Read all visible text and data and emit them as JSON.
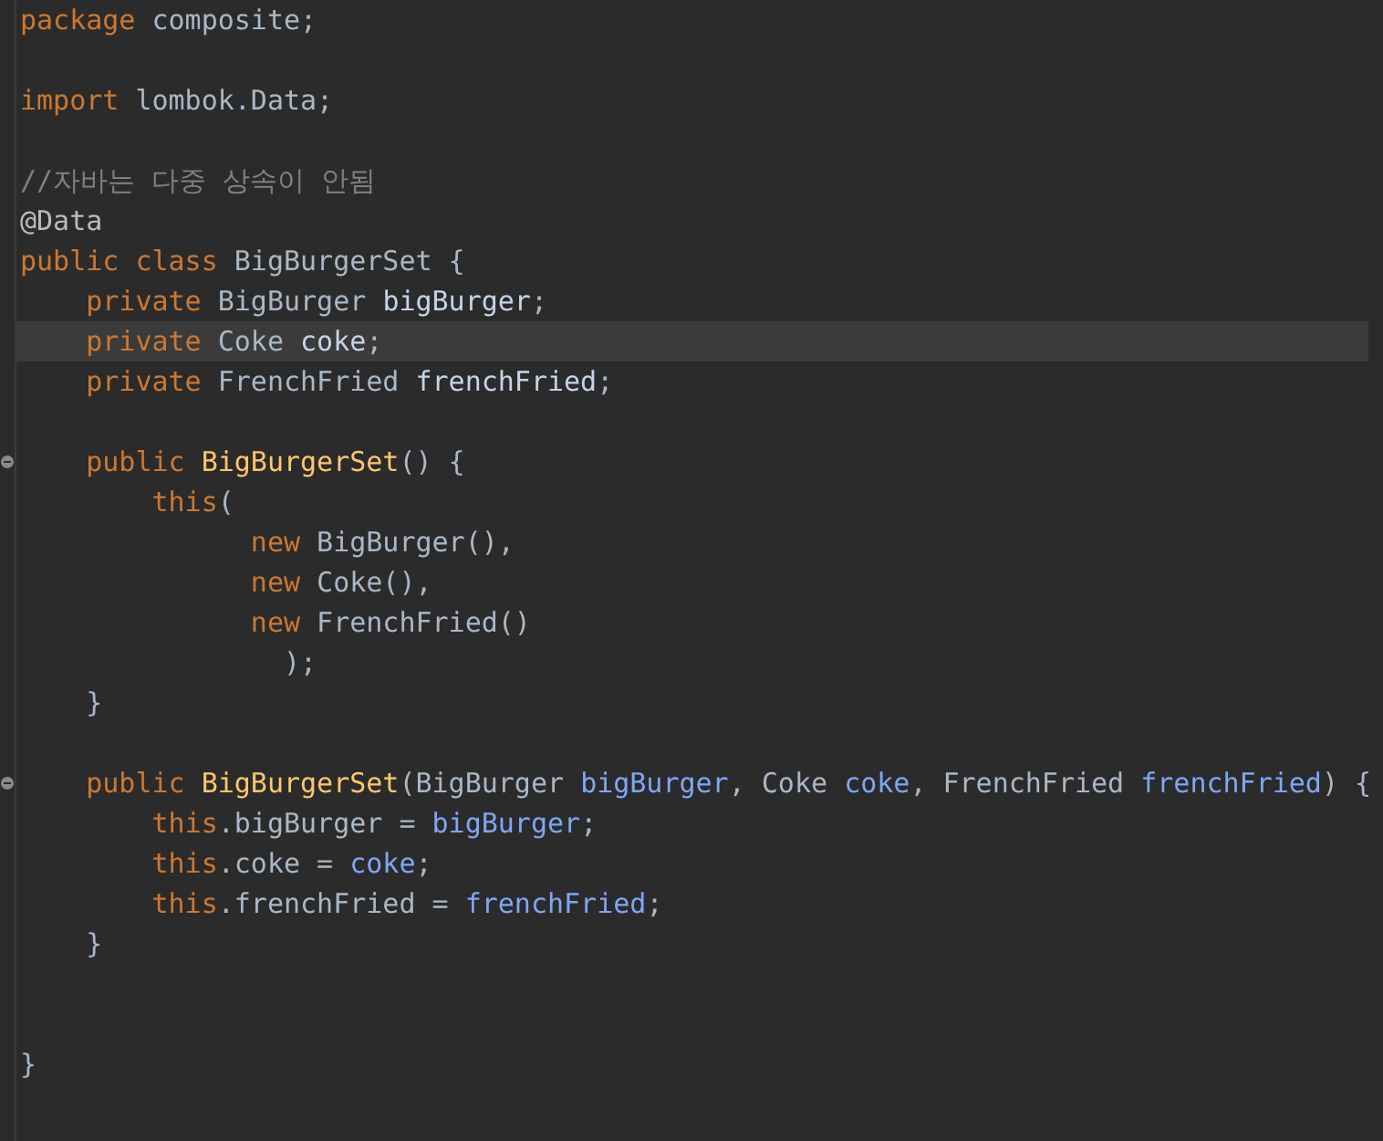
{
  "editor": {
    "lines": [
      {
        "current": false,
        "foldable": false,
        "tokens": [
          {
            "kind": "keyword",
            "text": "package"
          },
          {
            "kind": "plain",
            "text": " composite;"
          }
        ]
      },
      {
        "current": false,
        "foldable": false
      },
      {
        "current": false,
        "foldable": false,
        "tokens": [
          {
            "kind": "keyword",
            "text": "import"
          },
          {
            "kind": "plain",
            "text": " lombok.Data;"
          }
        ]
      },
      {
        "current": false,
        "foldable": false
      },
      {
        "current": false,
        "foldable": false,
        "tokens": [
          {
            "kind": "comment",
            "text": "//자바는 다중 상속이 안됨"
          }
        ]
      },
      {
        "current": false,
        "foldable": false,
        "tokens": [
          {
            "kind": "annotation",
            "text": "@Data"
          }
        ]
      },
      {
        "current": false,
        "foldable": false,
        "tokens": [
          {
            "kind": "keyword",
            "text": "public class"
          },
          {
            "kind": "plain",
            "text": " BigBurgerSet {"
          }
        ]
      },
      {
        "current": false,
        "foldable": false,
        "tokens": [
          {
            "kind": "keyword",
            "text": "    private"
          },
          {
            "kind": "plain",
            "text": " BigBurger "
          },
          {
            "kind": "field",
            "text": "bigBurger"
          },
          {
            "kind": "plain",
            "text": ";"
          }
        ]
      },
      {
        "current": true,
        "foldable": false,
        "tokens": [
          {
            "kind": "keyword",
            "text": "    private"
          },
          {
            "kind": "plain",
            "text": " Coke "
          },
          {
            "kind": "field",
            "text": "coke"
          },
          {
            "kind": "plain",
            "text": ";"
          }
        ]
      },
      {
        "current": false,
        "foldable": false,
        "tokens": [
          {
            "kind": "keyword",
            "text": "    private"
          },
          {
            "kind": "plain",
            "text": " FrenchFried "
          },
          {
            "kind": "field",
            "text": "frenchFried"
          },
          {
            "kind": "plain",
            "text": ";"
          }
        ]
      },
      {
        "current": false,
        "foldable": false
      },
      {
        "current": false,
        "foldable": true,
        "tokens": [
          {
            "kind": "keyword",
            "text": "    public "
          },
          {
            "kind": "method",
            "text": "BigBurgerSet"
          },
          {
            "kind": "plain",
            "text": "() {"
          }
        ]
      },
      {
        "current": false,
        "foldable": false,
        "tokens": [
          {
            "kind": "keyword",
            "text": "        this"
          },
          {
            "kind": "plain",
            "text": "("
          }
        ]
      },
      {
        "current": false,
        "foldable": false,
        "tokens": [
          {
            "kind": "keyword",
            "text": "              new"
          },
          {
            "kind": "plain",
            "text": " BigBurger(),"
          }
        ]
      },
      {
        "current": false,
        "foldable": false,
        "tokens": [
          {
            "kind": "keyword",
            "text": "              new"
          },
          {
            "kind": "plain",
            "text": " Coke(),"
          }
        ]
      },
      {
        "current": false,
        "foldable": false,
        "tokens": [
          {
            "kind": "keyword",
            "text": "              new"
          },
          {
            "kind": "plain",
            "text": " FrenchFried()"
          }
        ]
      },
      {
        "current": false,
        "foldable": false,
        "tokens": [
          {
            "kind": "plain",
            "text": "                );"
          }
        ]
      },
      {
        "current": false,
        "foldable": false,
        "tokens": [
          {
            "kind": "plain",
            "text": "    }"
          }
        ]
      },
      {
        "current": false,
        "foldable": false
      },
      {
        "current": false,
        "foldable": true,
        "tokens": [
          {
            "kind": "keyword",
            "text": "    public "
          },
          {
            "kind": "method",
            "text": "BigBurgerSet"
          },
          {
            "kind": "plain",
            "text": "(BigBurger "
          },
          {
            "kind": "param",
            "text": "bigBurger"
          },
          {
            "kind": "plain",
            "text": ", Coke "
          },
          {
            "kind": "param",
            "text": "coke"
          },
          {
            "kind": "plain",
            "text": ", FrenchFried "
          },
          {
            "kind": "param",
            "text": "frenchFried"
          },
          {
            "kind": "plain",
            "text": ") {"
          }
        ]
      },
      {
        "current": false,
        "foldable": false,
        "tokens": [
          {
            "kind": "keyword",
            "text": "        this"
          },
          {
            "kind": "plain",
            "text": ".bigBurger = "
          },
          {
            "kind": "param",
            "text": "bigBurger"
          },
          {
            "kind": "plain",
            "text": ";"
          }
        ]
      },
      {
        "current": false,
        "foldable": false,
        "tokens": [
          {
            "kind": "keyword",
            "text": "        this"
          },
          {
            "kind": "plain",
            "text": ".coke = "
          },
          {
            "kind": "param",
            "text": "coke"
          },
          {
            "kind": "plain",
            "text": ";"
          }
        ]
      },
      {
        "current": false,
        "foldable": false,
        "tokens": [
          {
            "kind": "keyword",
            "text": "        this"
          },
          {
            "kind": "plain",
            "text": ".frenchFried = "
          },
          {
            "kind": "param",
            "text": "frenchFried"
          },
          {
            "kind": "plain",
            "text": ";"
          }
        ]
      },
      {
        "current": false,
        "foldable": false,
        "tokens": [
          {
            "kind": "plain",
            "text": "    }"
          }
        ]
      },
      {
        "current": false,
        "foldable": false
      },
      {
        "current": false,
        "foldable": false
      },
      {
        "current": false,
        "foldable": false,
        "tokens": [
          {
            "kind": "plain",
            "text": "}"
          }
        ]
      }
    ]
  }
}
